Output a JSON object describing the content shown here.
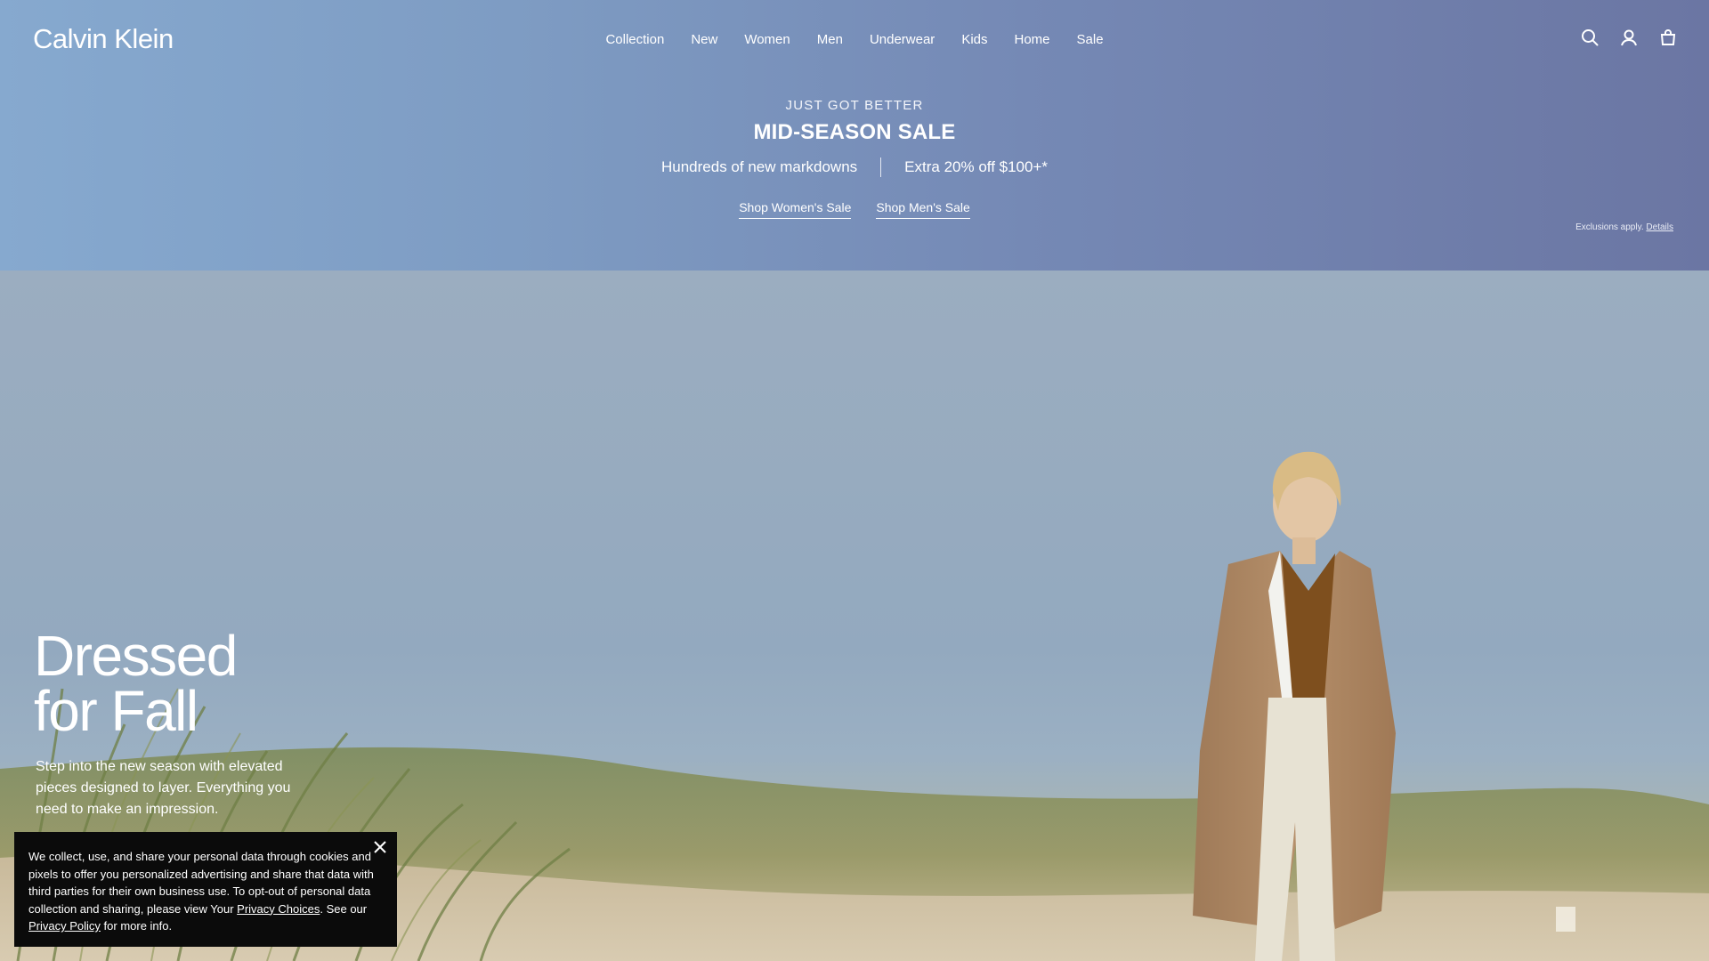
{
  "header": {
    "logo": "Calvin Klein",
    "nav": [
      "Collection",
      "New",
      "Women",
      "Men",
      "Underwear",
      "Kids",
      "Home",
      "Sale"
    ],
    "icons": [
      "search-icon",
      "account-icon",
      "bag-icon"
    ]
  },
  "promo": {
    "eyebrow": "JUST GOT BETTER",
    "headline": "MID-SEASON SALE",
    "sub_left": "Hundreds of new markdowns",
    "sub_right": "Extra 20% off $100+*",
    "cta_women": "Shop Women's Sale",
    "cta_men": "Shop Men's Sale",
    "exclusions_text": "Exclusions apply.",
    "exclusions_link": "Details"
  },
  "hero": {
    "title": "Dressed\nfor Fall",
    "copy": "Step into the new season with elevated pieces designed to layer. Everything you need to make an impression."
  },
  "cookie": {
    "text_1": "We collect, use, and share your personal data through cookies and pixels to offer you personalized advertising and share that data with third parties for their own business use. To opt-out of personal data collection and sharing, please view Your ",
    "link_1": "Privacy Choices",
    "text_2": ". See our ",
    "link_2": "Privacy Policy",
    "text_3": " for more info."
  },
  "colors": {
    "promo_start": "#86a9cf",
    "promo_end": "#6b76a3",
    "cookie_bg": "#0b0b0b"
  }
}
